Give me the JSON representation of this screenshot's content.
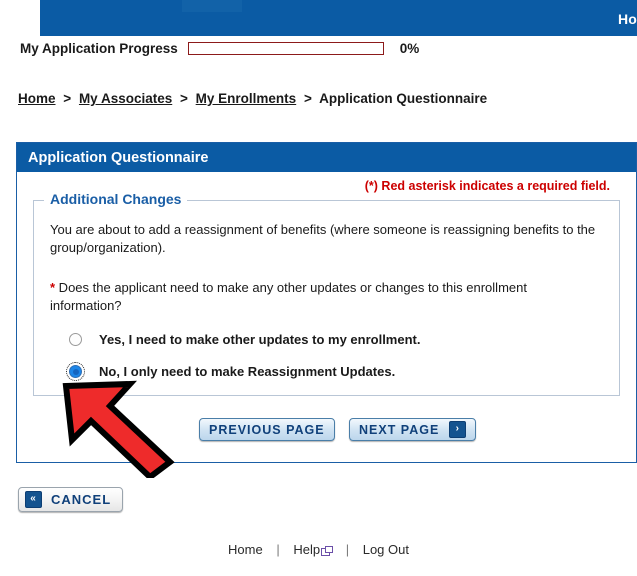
{
  "banner": {
    "home_link": "Ho"
  },
  "progress": {
    "label": "My Application Progress",
    "percent_text": "0%",
    "percent_value": 0
  },
  "breadcrumb": {
    "items": [
      {
        "label": "Home",
        "link": true
      },
      {
        "label": "My Associates",
        "link": true
      },
      {
        "label": "My Enrollments",
        "link": true
      },
      {
        "label": "Application Questionnaire",
        "link": false
      }
    ],
    "separator": ">"
  },
  "panel": {
    "title": "Application Questionnaire",
    "required_note": "(*) Red asterisk indicates a required field.",
    "fieldset": {
      "legend": "Additional Changes",
      "intro": "You are about to add a reassignment of benefits (where someone is reassigning benefits to the group/organization).",
      "question_star": "*",
      "question": " Does the applicant need to make any other updates or changes to this enrollment information?",
      "options": [
        {
          "label": "Yes, I need to make other updates to my enrollment.",
          "selected": false
        },
        {
          "label": "No, I only need to make Reassignment Updates.",
          "selected": true
        }
      ]
    }
  },
  "buttons": {
    "previous": "PREVIOUS PAGE",
    "previous_visible": "REVIOUS PAGE",
    "next": "NEXT PAGE",
    "next_icon": "›",
    "cancel": "CANCEL",
    "cancel_icon": "«"
  },
  "footer": {
    "home": "Home",
    "help": "Help",
    "logout": "Log Out",
    "separator": "|"
  },
  "colors": {
    "brand_blue": "#0b5ba4",
    "required_red": "#cc0000",
    "link_blue": "#1a5ea6",
    "arrow_red": "#ee2b2b"
  }
}
